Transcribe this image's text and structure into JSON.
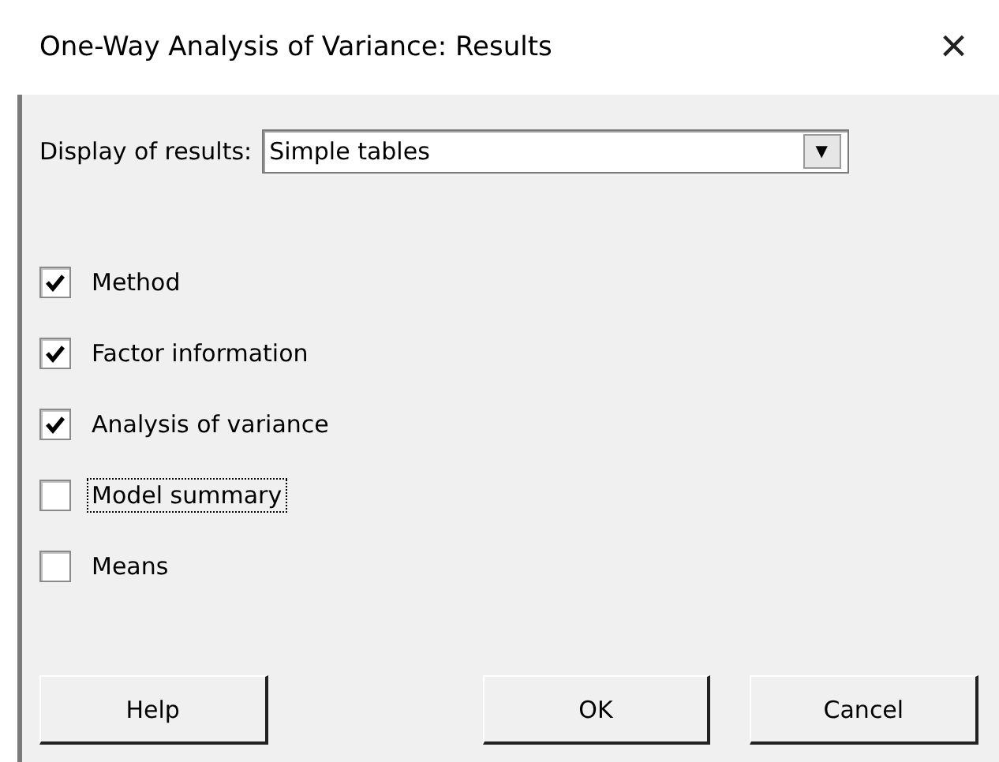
{
  "window": {
    "title": "One-Way Analysis of Variance: Results",
    "close": "×"
  },
  "display": {
    "label": "Display of results:",
    "value": "Simple tables",
    "arrow": "▼"
  },
  "options": [
    {
      "label": "Method",
      "checked": true,
      "focused": false
    },
    {
      "label": "Factor information",
      "checked": true,
      "focused": false
    },
    {
      "label": "Analysis of variance",
      "checked": true,
      "focused": false
    },
    {
      "label": "Model summary",
      "checked": false,
      "focused": true
    },
    {
      "label": "Means",
      "checked": false,
      "focused": false
    }
  ],
  "buttons": [
    "Help",
    "OK",
    "Cancel"
  ]
}
